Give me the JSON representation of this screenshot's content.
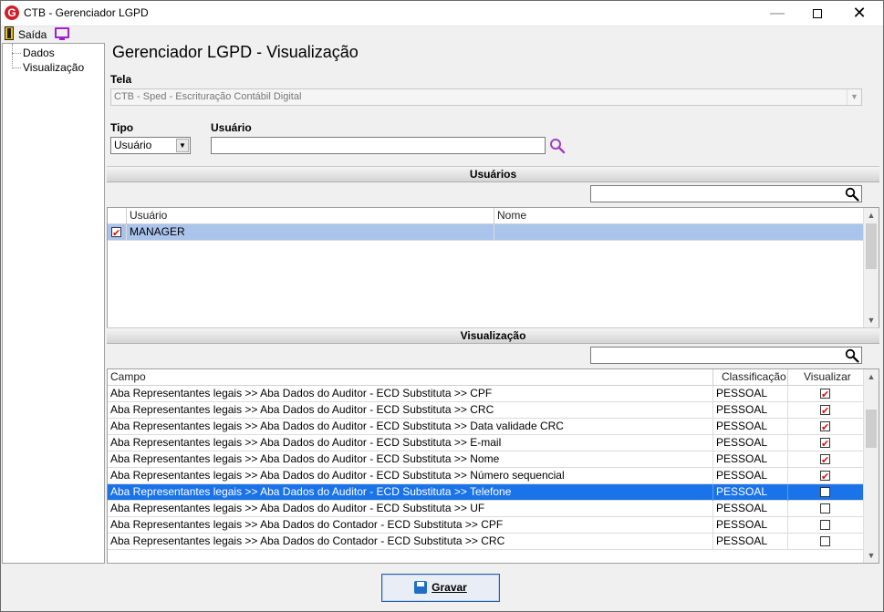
{
  "window": {
    "title": "CTB - Gerenciador LGPD",
    "app_icon_letter": "G"
  },
  "toolbar": {
    "exit_label": "Saída"
  },
  "tree": {
    "items": [
      {
        "label": "Dados"
      },
      {
        "label": "Visualização"
      }
    ]
  },
  "main": {
    "heading": "Gerenciador LGPD - Visualização",
    "tela_label": "Tela",
    "tela_value": "CTB - Sped - Escrituração Contábil Digital",
    "tipo_label": "Tipo",
    "tipo_value": "Usuário",
    "usuario_label": "Usuário",
    "usuario_value": ""
  },
  "usuarios": {
    "section_title": "Usuários",
    "search_value": "",
    "columns": [
      "Usuário",
      "Nome"
    ],
    "rows": [
      {
        "checked": true,
        "usuario": "MANAGER",
        "nome": ""
      }
    ]
  },
  "visualizacao": {
    "section_title": "Visualização",
    "search_value": "",
    "columns": [
      "Campo",
      "Classificação",
      "Visualizar"
    ],
    "rows": [
      {
        "campo": "Aba Representantes legais >> Aba Dados do Auditor - ECD Substituta >> CPF",
        "classificacao": "PESSOAL",
        "visualizar": true
      },
      {
        "campo": "Aba Representantes legais >> Aba Dados do Auditor - ECD Substituta >> CRC",
        "classificacao": "PESSOAL",
        "visualizar": true
      },
      {
        "campo": "Aba Representantes legais >> Aba Dados do Auditor - ECD Substituta >> Data validade CRC",
        "classificacao": "PESSOAL",
        "visualizar": true
      },
      {
        "campo": "Aba Representantes legais >> Aba Dados do Auditor - ECD Substituta >> E-mail",
        "classificacao": "PESSOAL",
        "visualizar": true
      },
      {
        "campo": "Aba Representantes legais >> Aba Dados do Auditor - ECD Substituta >> Nome",
        "classificacao": "PESSOAL",
        "visualizar": true
      },
      {
        "campo": "Aba Representantes legais >> Aba Dados do Auditor - ECD Substituta >> Número sequencial",
        "classificacao": "PESSOAL",
        "visualizar": true
      },
      {
        "campo": "Aba Representantes legais >> Aba Dados do Auditor - ECD Substituta >> Telefone",
        "classificacao": "PESSOAL",
        "visualizar": false,
        "selected": true
      },
      {
        "campo": "Aba Representantes legais >> Aba Dados do Auditor - ECD Substituta >> UF",
        "classificacao": "PESSOAL",
        "visualizar": false
      },
      {
        "campo": "Aba Representantes legais >> Aba Dados do Contador - ECD Substituta >> CPF",
        "classificacao": "PESSOAL",
        "visualizar": false
      },
      {
        "campo": "Aba Representantes legais >> Aba Dados do Contador - ECD Substituta >> CRC",
        "classificacao": "PESSOAL",
        "visualizar": false
      }
    ]
  },
  "footer": {
    "save_label": "Gravar"
  },
  "colors": {
    "selected_row": "#1a73e8",
    "selected_row_light": "#aac4ec",
    "check_mark": "#dd1111",
    "lookup_icon": "#a040c0"
  }
}
